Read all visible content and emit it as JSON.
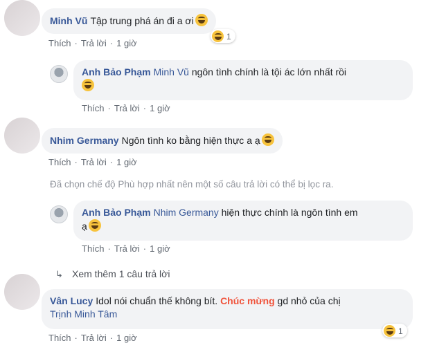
{
  "comments": [
    {
      "author": "Minh Vũ",
      "text": "Tập trung phá án đi a ơi",
      "reaction_count": "1",
      "like": "Thích",
      "reply": "Trả lời",
      "time": "1 giờ"
    },
    {
      "author": "Anh Bảo Phạm",
      "mention": "Minh Vũ",
      "text": "ngôn tình chính là tội ác lớn nhất rồi",
      "like": "Thích",
      "reply": "Trả lời",
      "time": "1 giờ"
    },
    {
      "author": "Nhim Germany",
      "text": "Ngôn tình ko bằng hiện thực a ạ",
      "like": "Thích",
      "reply": "Trả lời",
      "time": "1 giờ"
    },
    {
      "author": "Anh Bảo Phạm",
      "mention": "Nhim Germany",
      "text_line1": "hiện thực chính là ngôn tình em",
      "text_line2": "ạ",
      "like": "Thích",
      "reply": "Trả lời",
      "time": "1 giờ"
    },
    {
      "author": "Vân Lucy",
      "text_before": "Idol nói chuẩn thế không bít.",
      "highlight": "Chúc mừng",
      "text_after": "gd nhỏ của chị",
      "mention": "Trịnh Minh Tâm",
      "reaction_count": "1",
      "like": "Thích",
      "reply": "Trả lời",
      "time": "1 giờ"
    }
  ],
  "filter_note": "Đã chọn chế độ Phù hợp nhất nên một số câu trả lời có thể bị lọc ra.",
  "view_more": "Xem thêm 1 câu trả lời",
  "icons": {
    "reaction": "laughing-emoji-icon",
    "reply_arrow": "reply-arrow-icon"
  },
  "colors": {
    "name": "#385898",
    "bubble": "#f2f3f5",
    "highlight": "#f0533b",
    "meta": "#606770"
  }
}
